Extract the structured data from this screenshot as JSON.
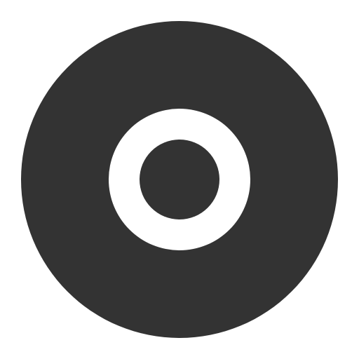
{
  "icon": {
    "name": "record-button-icon",
    "colors": {
      "fill": "#333333",
      "ring": "#ffffff",
      "background": "#ffffff"
    }
  }
}
